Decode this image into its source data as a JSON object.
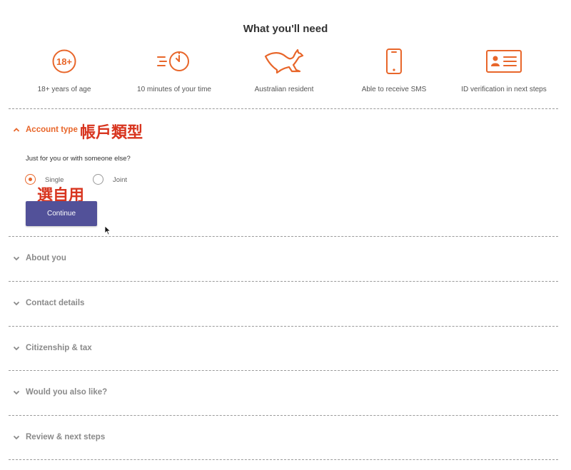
{
  "heading": "What you'll need",
  "requirements": [
    {
      "icon": "age-18-plus-icon",
      "label": "18+ years of age",
      "icon_text": "18+"
    },
    {
      "icon": "clock-time-icon",
      "label": "10 minutes of your time"
    },
    {
      "icon": "kangaroo-icon",
      "label": "Australian resident"
    },
    {
      "icon": "mobile-phone-icon",
      "label": "Able to receive SMS"
    },
    {
      "icon": "id-card-icon",
      "label": "ID verification in next steps"
    }
  ],
  "account_type": {
    "title": "Account type",
    "annotation": "帳戶類型",
    "question": "Just for you or with someone else?",
    "options": [
      {
        "label": "Single",
        "selected": true
      },
      {
        "label": "Joint",
        "selected": false
      }
    ],
    "selection_annotation": "選自用",
    "continue_label": "Continue"
  },
  "sections": [
    {
      "title": "About you"
    },
    {
      "title": "Contact details"
    },
    {
      "title": "Citizenship & tax"
    },
    {
      "title": "Would you also like?"
    },
    {
      "title": "Review & next steps"
    }
  ],
  "colors": {
    "accent": "#e8662a",
    "button": "#525199",
    "annotation": "#d8351f",
    "muted": "#8a8a8a"
  }
}
